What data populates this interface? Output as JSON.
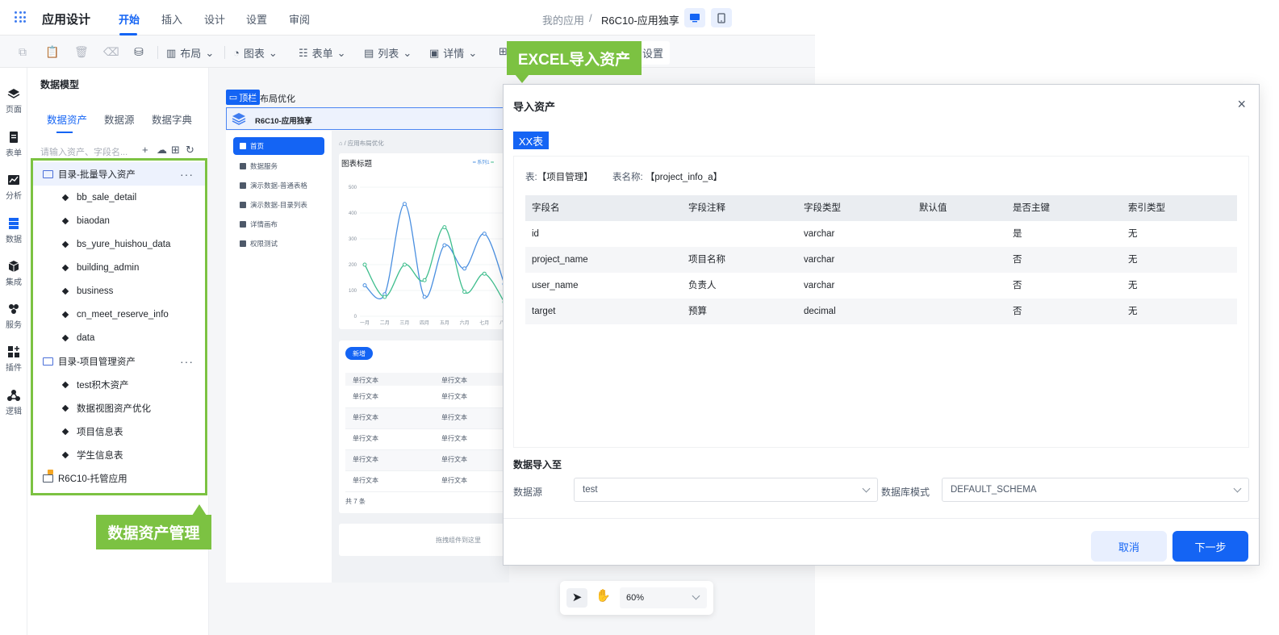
{
  "header": {
    "app_title": "应用设计",
    "tabs": [
      "开始",
      "插入",
      "设计",
      "设置",
      "审阅"
    ],
    "breadcrumb_root": "我的应用",
    "breadcrumb_sep": "/",
    "breadcrumb_current": "R6C10-应用独享"
  },
  "toolbar": {
    "layout": "布局",
    "chart": "图表",
    "form": "表单",
    "list": "列表",
    "detail": "详情",
    "settings": "设置"
  },
  "rail": [
    "页面",
    "表单",
    "分析",
    "数据",
    "集成",
    "服务",
    "插件",
    "逻辑"
  ],
  "panel": {
    "title": "数据模型",
    "tabs": [
      "数据资产",
      "数据源",
      "数据字典"
    ],
    "search_placeholder": "请输入资产、字段名...",
    "folders": [
      {
        "label": "目录-批量导入资产",
        "more": "···",
        "items": [
          "bb_sale_detail",
          "biaodan",
          "bs_yure_huishou_data",
          "building_admin",
          "business",
          "cn_meet_reserve_info",
          "data"
        ]
      },
      {
        "label": "目录-项目管理资产",
        "more": "···",
        "items": [
          "test积木资产",
          "数据视图资产优化",
          "项目信息表",
          "学生信息表"
        ]
      },
      {
        "label": "R6C10-托管应用",
        "items": []
      }
    ]
  },
  "callouts": {
    "excel": "EXCEL导入资产",
    "asset_mgmt": "数据资产管理"
  },
  "canvas": {
    "top_label": "顶栏",
    "layout_title": "布局优化",
    "app_name": "R6C10-应用独享",
    "nav": [
      "首页",
      "数据服务",
      "演示数据-普通表格",
      "演示数据-目录列表",
      "详情画布",
      "权限测试"
    ],
    "breadcrumb": "应用布局优化",
    "chart_title": "图表标题",
    "legend": [
      "系列1"
    ],
    "add_btn": "新增",
    "table_header": [
      "单行文本",
      "单行文本"
    ],
    "table_cell": "单行文本",
    "table_total": "共 7 条",
    "drop_hint": "拖拽组件到这里",
    "zoom": "60%"
  },
  "chart_data": {
    "type": "line",
    "categories": [
      "一月",
      "二月",
      "三月",
      "四月",
      "五月",
      "六月",
      "七月",
      "八月"
    ],
    "series": [
      {
        "values": [
          120,
          85,
          435,
          75,
          275,
          185,
          320,
          125
        ]
      },
      {
        "values": [
          200,
          75,
          200,
          140,
          345,
          95,
          165,
          55
        ]
      }
    ],
    "yticks": [
      0,
      100,
      200,
      300,
      400,
      500
    ],
    "ylim": [
      0,
      500
    ],
    "colors": [
      "#4a8fe0",
      "#3dbd8c"
    ]
  },
  "dialog": {
    "title": "导入资产",
    "close": "×",
    "table_tag": "XX表",
    "meta_table_label": "表:",
    "meta_table_value": "【项目管理】",
    "meta_name_label": "表名称:",
    "meta_name_value": "【project_info_a】",
    "columns": [
      "字段名",
      "字段注释",
      "字段类型",
      "默认值",
      "是否主键",
      "索引类型"
    ],
    "rows": [
      [
        "id",
        "",
        "varchar",
        "",
        "是",
        "无"
      ],
      [
        "project_name",
        "项目名称",
        "varchar",
        "",
        "否",
        "无"
      ],
      [
        "user_name",
        "负责人",
        "varchar",
        "",
        "否",
        "无"
      ],
      [
        "target",
        "预算",
        "decimal",
        "",
        "否",
        "无"
      ]
    ],
    "import_to": "数据导入至",
    "ds_label": "数据源",
    "ds_value": "test",
    "schema_label": "数据库模式",
    "schema_value": "DEFAULT_SCHEMA",
    "cancel": "取消",
    "next": "下一步"
  }
}
